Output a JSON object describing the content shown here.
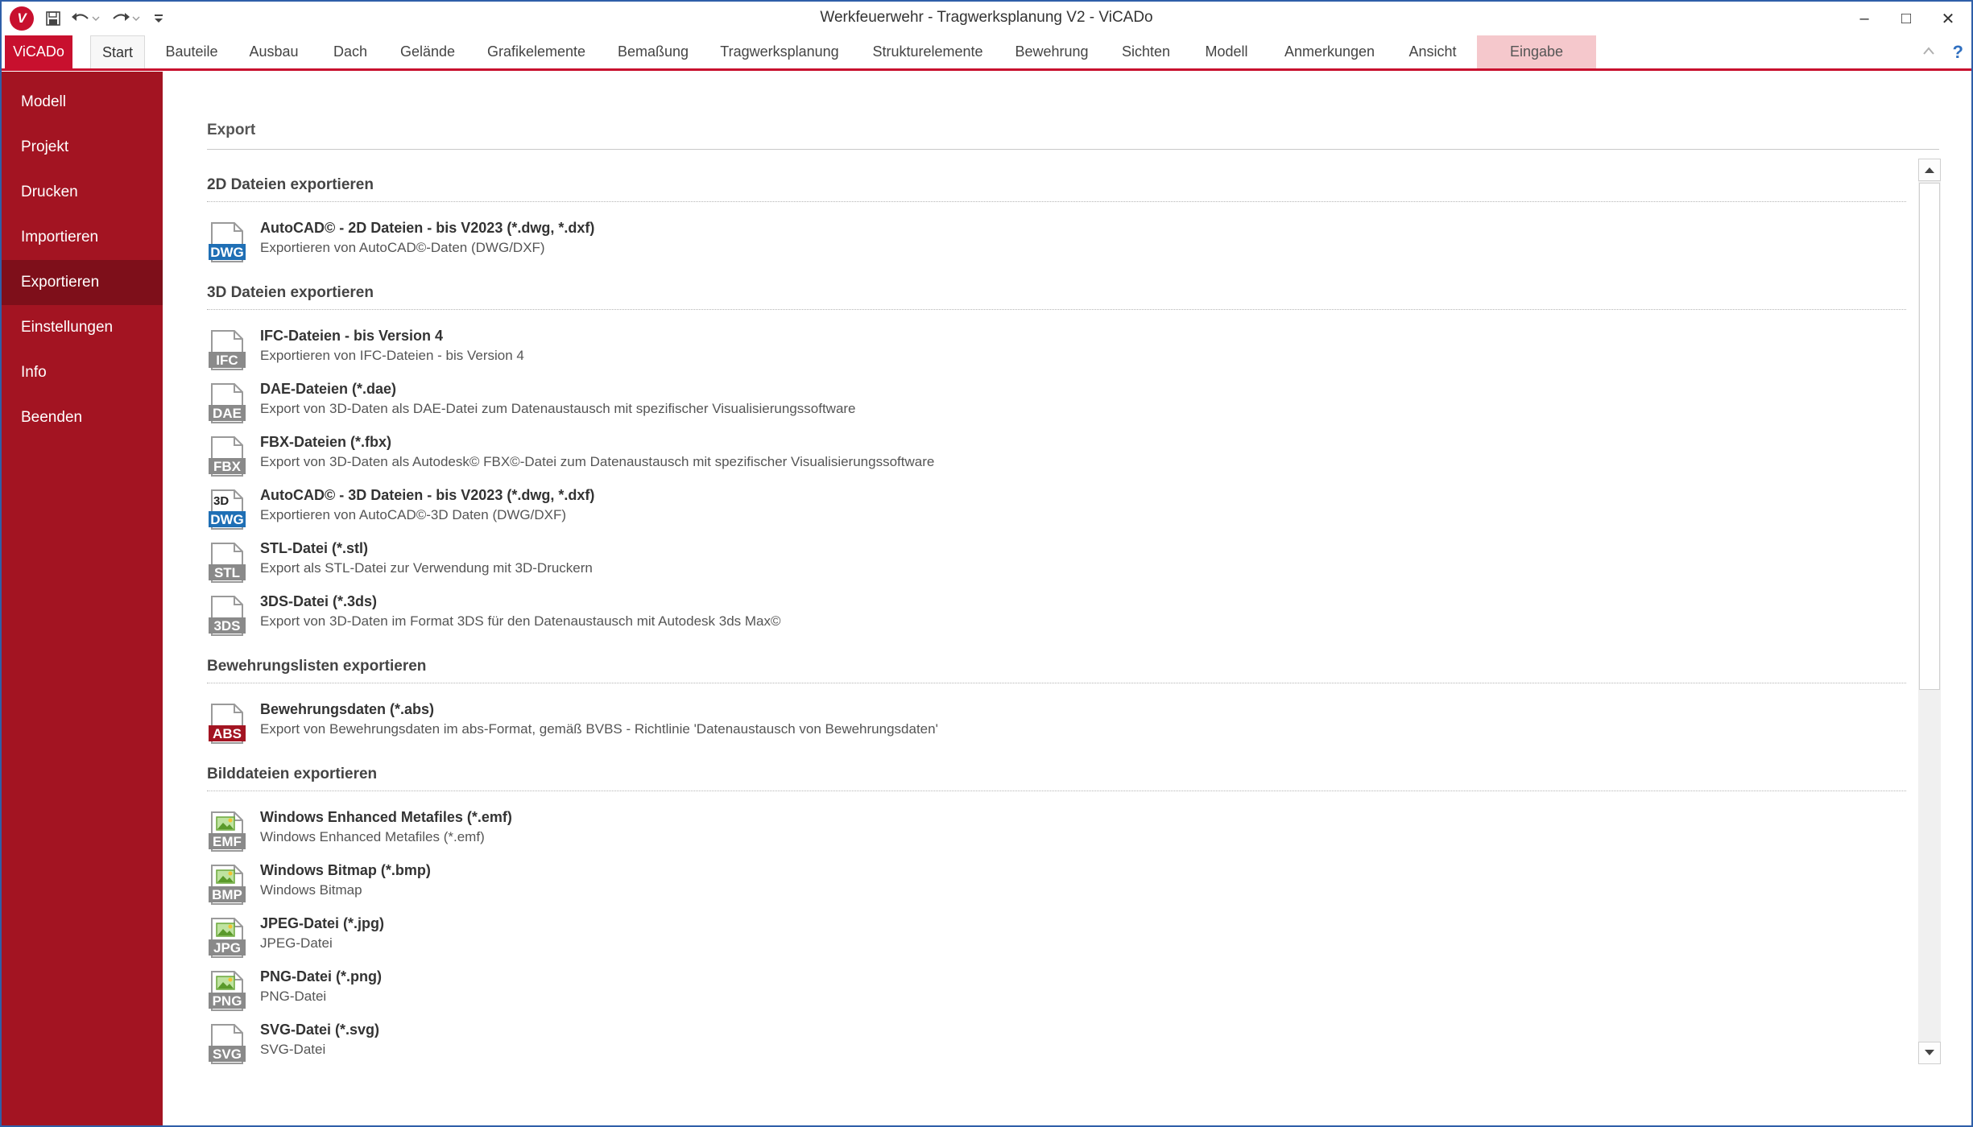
{
  "window": {
    "title": "Werkfeuerwehr - Tragwerksplanung V2 - ViCADo",
    "logo_text": "V",
    "minimize": "–",
    "maximize": "□",
    "close": "✕"
  },
  "ribbon": {
    "file_tab": "ViCADo",
    "tabs": [
      "Start",
      "Bauteile",
      "Ausbau",
      "Dach",
      "Gelände",
      "Grafikelemente",
      "Bemaßung",
      "Tragwerksplanung",
      "Strukturelemente",
      "Bewehrung",
      "Sichten",
      "Modell",
      "Anmerkungen",
      "Ansicht"
    ],
    "context_tab": "Eingabe",
    "help": "?"
  },
  "sidebar": {
    "items": [
      "Modell",
      "Projekt",
      "Drucken",
      "Importieren",
      "Exportieren",
      "Einstellungen",
      "Info",
      "Beenden"
    ],
    "active_index": 4
  },
  "main": {
    "section_title": "Export",
    "groups": [
      {
        "header": "2D Dateien exportieren",
        "entries": [
          {
            "title": "AutoCAD© - 2D Dateien - bis V2023 (*.dwg, *.dxf)",
            "desc": "Exportieren von AutoCAD©-Daten (DWG/DXF)",
            "icon": "dwg-file-icon",
            "icon_label": "DWG",
            "icon_color": "#1f6fb5"
          }
        ]
      },
      {
        "header": "3D Dateien exportieren",
        "entries": [
          {
            "title": "IFC-Dateien - bis Version 4",
            "desc": "Exportieren von IFC-Dateien - bis Version 4",
            "icon": "ifc-file-icon",
            "icon_label": "IFC",
            "icon_color": "#8a8a8a"
          },
          {
            "title": "DAE-Dateien (*.dae)",
            "desc": "Export von 3D-Daten als DAE-Datei zum Datenaustausch mit spezifischer Visualisierungssoftware",
            "icon": "dae-file-icon",
            "icon_label": "DAE",
            "icon_color": "#8a8a8a"
          },
          {
            "title": "FBX-Dateien (*.fbx)",
            "desc": "Export von 3D-Daten als Autodesk© FBX©-Datei zum Datenaustausch mit spezifischer Visualisierungssoftware",
            "icon": "fbx-file-icon",
            "icon_label": "FBX",
            "icon_color": "#8a8a8a"
          },
          {
            "title": "AutoCAD© - 3D Dateien - bis V2023 (*.dwg, *.dxf)",
            "desc": "Exportieren von AutoCAD©-3D Daten (DWG/DXF)",
            "icon": "dwg-3d-file-icon",
            "icon_label": "DWG",
            "icon_badge": "3D",
            "icon_color": "#1f6fb5"
          },
          {
            "title": "STL-Datei (*.stl)",
            "desc": "Export als STL-Datei zur Verwendung mit 3D-Druckern",
            "icon": "stl-file-icon",
            "icon_label": "STL",
            "icon_color": "#8a8a8a"
          },
          {
            "title": "3DS-Datei (*.3ds)",
            "desc": "Export von 3D-Daten im Format 3DS für den Datenaustausch mit Autodesk 3ds Max©",
            "icon": "3ds-file-icon",
            "icon_label": "3DS",
            "icon_color": "#8a8a8a"
          }
        ]
      },
      {
        "header": "Bewehrungslisten exportieren",
        "entries": [
          {
            "title": "Bewehrungsdaten (*.abs)",
            "desc": "Export von Bewehrungsdaten im abs-Format, gemäß BVBS - Richtlinie 'Datenaustausch von Bewehrungsdaten'",
            "icon": "abs-file-icon",
            "icon_label": "ABS",
            "icon_color": "#a31422"
          }
        ]
      },
      {
        "header": "Bilddateien exportieren",
        "entries": [
          {
            "title": "Windows Enhanced Metafiles (*.emf)",
            "desc": "Windows Enhanced Metafiles (*.emf)",
            "icon": "emf-image-icon",
            "icon_label": "EMF",
            "icon_color": "#8a8a8a",
            "image": true
          },
          {
            "title": "Windows Bitmap (*.bmp)",
            "desc": "Windows Bitmap",
            "icon": "bmp-image-icon",
            "icon_label": "BMP",
            "icon_color": "#8a8a8a",
            "image": true
          },
          {
            "title": "JPEG-Datei (*.jpg)",
            "desc": "JPEG-Datei",
            "icon": "jpg-image-icon",
            "icon_label": "JPG",
            "icon_color": "#8a8a8a",
            "image": true
          },
          {
            "title": "PNG-Datei (*.png)",
            "desc": "PNG-Datei",
            "icon": "png-image-icon",
            "icon_label": "PNG",
            "icon_color": "#8a8a8a",
            "image": true
          },
          {
            "title": "SVG-Datei (*.svg)",
            "desc": "SVG-Datei",
            "icon": "svg-file-icon",
            "icon_label": "SVG",
            "icon_color": "#8a8a8a"
          }
        ]
      }
    ]
  },
  "colors": {
    "accent": "#c8102e",
    "sidebar": "#a31422",
    "sidebar_active": "#7e0f1a",
    "context_tab": "#f5c8cc"
  }
}
